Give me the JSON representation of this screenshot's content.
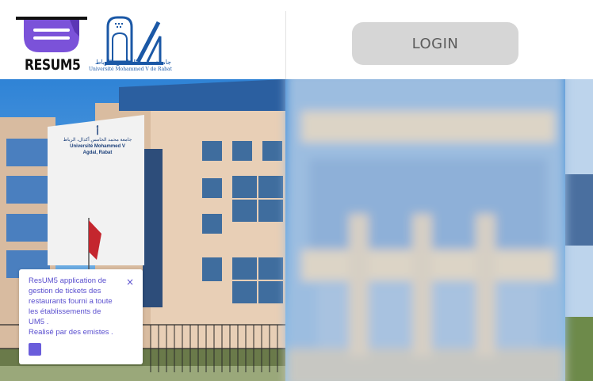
{
  "header": {
    "brand_name": "RESUM5",
    "university_caption_ar": "جامعة محمد الخامس بالرباط",
    "university_caption_fr": "Université Mohammed V de Rabat"
  },
  "login": {
    "label": "LOGIN"
  },
  "building_sign": {
    "arabic": "جامعة محمد الخامس أكدال، الرباط",
    "line1": "Université Mohammed V",
    "line2": "Agdal, Rabat"
  },
  "popup": {
    "lines": [
      "ResUM5 application de",
      "gestion de tickets des",
      "restaurants fourni a toute",
      "les établissements de",
      "UM5 .",
      "Realisé par des emistes ."
    ],
    "close_symbol": "×"
  },
  "colors": {
    "accent_purple": "#7b52d9",
    "um5_blue": "#1b58a6",
    "popup_text": "#5a4fcf",
    "login_bg": "#d6d6d6"
  }
}
